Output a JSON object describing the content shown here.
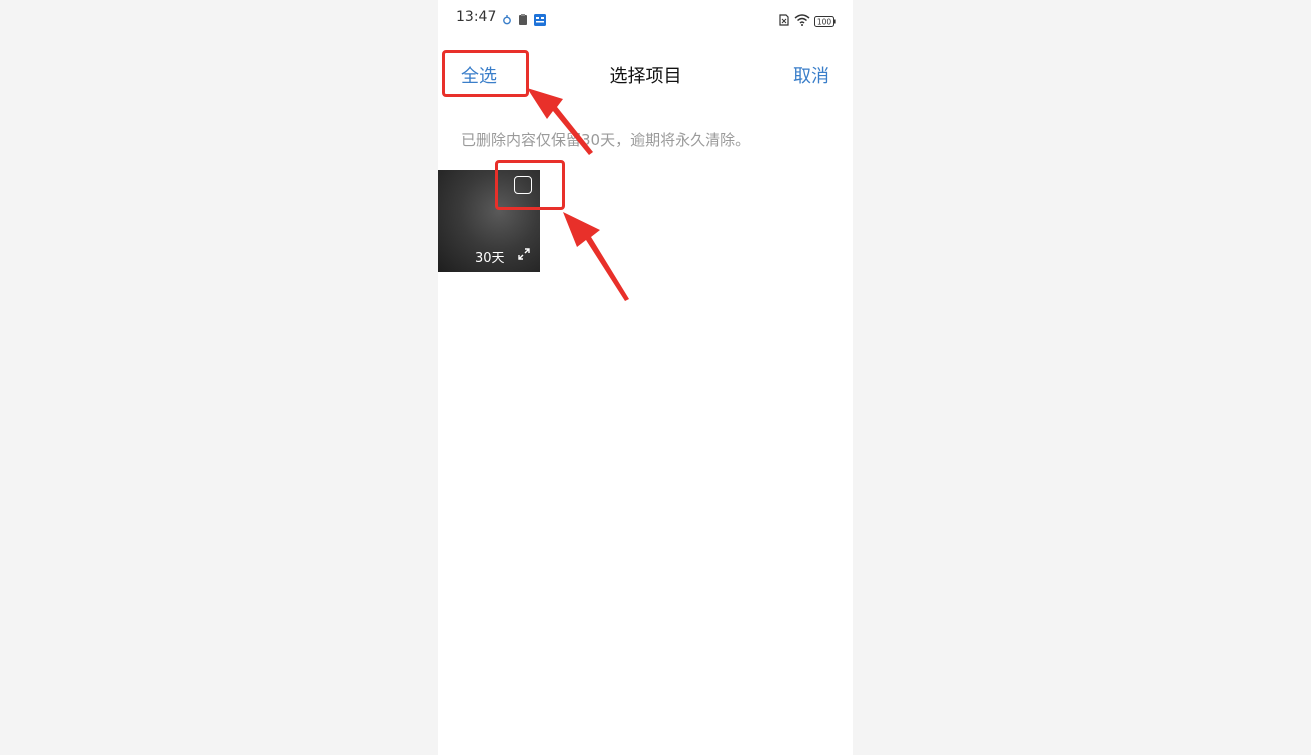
{
  "status_bar": {
    "time": "13:47",
    "battery": "100"
  },
  "header": {
    "select_all": "全选",
    "title": "选择项目",
    "cancel": "取消"
  },
  "notice": "已删除内容仅保留30天，逾期将永久清除。",
  "items": [
    {
      "days_left": "30天",
      "selected": false
    }
  ],
  "colors": {
    "accent": "#3a7ec9",
    "annotation": "#e8302a"
  }
}
